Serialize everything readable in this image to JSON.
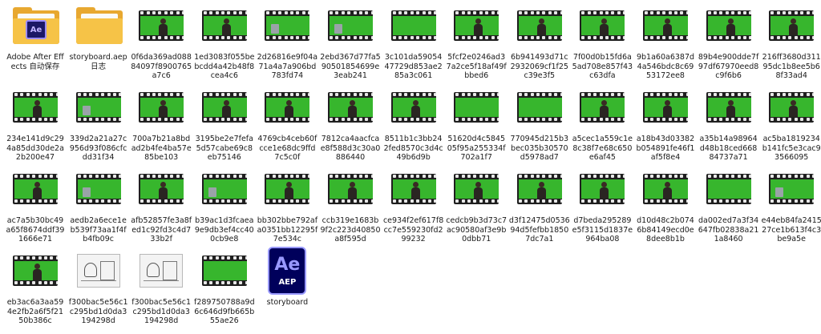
{
  "files": [
    {
      "kind": "folder-ae",
      "label": "Adobe After Effects 自动保存",
      "icon": "folder-icon",
      "badge": "Ae"
    },
    {
      "kind": "folder",
      "label": "storyboard.aep 日志",
      "icon": "folder-icon"
    },
    {
      "kind": "video",
      "label": "0f6da369ad08884097f8900765a7c6",
      "scene": "person"
    },
    {
      "kind": "video",
      "label": "1ed3083f055bebcdd4a42b48f8cea4c6",
      "scene": "person"
    },
    {
      "kind": "video",
      "label": "2d26816e9f04a71a4a7a906bd783fd74",
      "scene": "prop"
    },
    {
      "kind": "video",
      "label": "2ebd367d77fa590501854699e3eab241",
      "scene": "prop"
    },
    {
      "kind": "video",
      "label": "3c101da5905447729d853ae285a3c061",
      "scene": "empty"
    },
    {
      "kind": "video",
      "label": "5fcf2e0246ad37a2ce5f18af49fbbed6",
      "scene": "person"
    },
    {
      "kind": "video",
      "label": "6b941493d71c2932069cf1f25c39e3f5",
      "scene": "person"
    },
    {
      "kind": "video",
      "label": "7f00d0b15fd6a5ad708e857f43c63dfa",
      "scene": "person"
    },
    {
      "kind": "video",
      "label": "9b1a60a6387d4a546bdc8c6953172ee8",
      "scene": "person"
    },
    {
      "kind": "video",
      "label": "89b4e900dde7f97df67970eed8c9f6b6",
      "scene": "person"
    },
    {
      "kind": "video",
      "label": "216ff3680d31195dc1b8ee5b68f33ad4",
      "scene": "person"
    },
    {
      "kind": "video",
      "label": "234e141d9c294a85dd30de2a2b200e47",
      "scene": "person"
    },
    {
      "kind": "video",
      "label": "339d2a21a27c956d93f086cfcdd31f34",
      "scene": "prop"
    },
    {
      "kind": "video",
      "label": "700a7b21a8bdad2b4fe4ba57e85be103",
      "scene": "person"
    },
    {
      "kind": "video",
      "label": "3195be2e7fefa5d57cabe69c8eb75146",
      "scene": "person"
    },
    {
      "kind": "video",
      "label": "4769cb4ceb60fcce1e68dc9ffd7c5c0f",
      "scene": "person"
    },
    {
      "kind": "video",
      "label": "7812ca4aacfcae8f588d3c30a0886440",
      "scene": "person"
    },
    {
      "kind": "video",
      "label": "8511b1c3bb242fed8570c3d4c49b6d9b",
      "scene": "person"
    },
    {
      "kind": "video",
      "label": "51620d4c584505f95a255334f702a1f7",
      "scene": "empty"
    },
    {
      "kind": "video",
      "label": "770945d215b3bec035b30570d5978ad7",
      "scene": "empty"
    },
    {
      "kind": "video",
      "label": "a5cec1a559c1e8c38f7e68c650e6af45",
      "scene": "person"
    },
    {
      "kind": "video",
      "label": "a18b43d03382b054891fe46f1af5f8e4",
      "scene": "person"
    },
    {
      "kind": "video",
      "label": "a35b14a98964d48b18ced66884737a71",
      "scene": "person"
    },
    {
      "kind": "video",
      "label": "ac5ba1819234b141fc5e3cac93566095",
      "scene": "person"
    },
    {
      "kind": "video",
      "label": "ac7a5b30bc49a65f8674ddf391666e71",
      "scene": "person"
    },
    {
      "kind": "video",
      "label": "aedb2a6ece1eb539f73aa1f4fb4fb09c",
      "scene": "prop"
    },
    {
      "kind": "video",
      "label": "afb52857fe3a8fed1c92fd3c4d733b2f",
      "scene": "person"
    },
    {
      "kind": "video",
      "label": "b39ac1d3fcaea9e9db3ef4cc400cb9e8",
      "scene": "prop"
    },
    {
      "kind": "video",
      "label": "bb302bbe792afa0351bb12295f7e534c",
      "scene": "person"
    },
    {
      "kind": "video",
      "label": "ccb319e1683b9f2c223d40850a8f595d",
      "scene": "person"
    },
    {
      "kind": "video",
      "label": "ce934f2ef617f8cc7e559230fd299232",
      "scene": "person"
    },
    {
      "kind": "video",
      "label": "cedcb9b3d73c7ac90580af3e9b0dbb71",
      "scene": "person"
    },
    {
      "kind": "video",
      "label": "d3f12475d053694d5fefbb18507dc7a1",
      "scene": "person"
    },
    {
      "kind": "video",
      "label": "d7beda295289e5f3115d1837e964ba08",
      "scene": "person"
    },
    {
      "kind": "video",
      "label": "d10d48c2b0746b84149ecd0e8dee8b1b",
      "scene": "person"
    },
    {
      "kind": "video",
      "label": "da002ed7a3f34647fb02838a211a8460",
      "scene": "empty"
    },
    {
      "kind": "video",
      "label": "e44eb84fa241527ce1b613f4c3be9a5e",
      "scene": "prop"
    },
    {
      "kind": "video",
      "label": "eb3ac6a3aa594e2fb2a6f5f2150b386c",
      "scene": "person"
    },
    {
      "kind": "sketch",
      "label": "f300bac5e56c1c295bd1d0da3194298d",
      "icon": "image-icon"
    },
    {
      "kind": "sketch",
      "label": "f300bac5e56c1c295bd1d0da3194298d",
      "icon": "image-icon"
    },
    {
      "kind": "video",
      "label": "f289750788a9d6c646d9fb665b55ae26",
      "scene": "empty"
    },
    {
      "kind": "aep",
      "label": "storyboard",
      "icon": "after-effects-project-icon",
      "badge": "Ae",
      "ext": "AEP"
    }
  ],
  "colors": {
    "greenscreen": "#37b62d",
    "folder": "#f6c347",
    "aeBlue": "#00005b",
    "aeAccent": "#9999ff"
  }
}
